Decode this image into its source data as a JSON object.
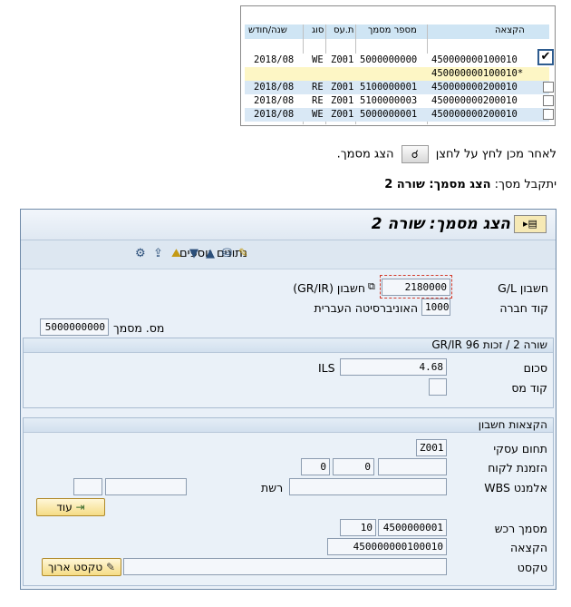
{
  "grid": {
    "columns": [
      "שנה/חודש",
      "סוג",
      "ת.עס",
      "מספר מסמך",
      "הקצאה"
    ],
    "rows": [
      {
        "period": "2018/08",
        "type": "WE",
        "code": "Z001",
        "doc": "5000000000",
        "assignment": "450000000100010",
        "checked": true,
        "style": "white"
      },
      {
        "period": "",
        "type": "",
        "code": "",
        "doc": "",
        "assignment": "450000000100010*",
        "checked": false,
        "style": "yellow"
      },
      {
        "period": "2018/08",
        "type": "RE",
        "code": "Z001",
        "doc": "5100000001",
        "assignment": "450000000200010",
        "checked": false,
        "style": "blue"
      },
      {
        "period": "2018/08",
        "type": "RE",
        "code": "Z001",
        "doc": "5100000003",
        "assignment": "450000000200010",
        "checked": false,
        "style": "white"
      },
      {
        "period": "2018/08",
        "type": "WE",
        "code": "Z001",
        "doc": "5000000001",
        "assignment": "450000000200010",
        "checked": false,
        "style": "blue"
      }
    ]
  },
  "instructions": {
    "line1_before": "לאחר מכן לחץ על לחצן",
    "line1_after": "הצג מסמך.",
    "line2_prefix": "יתקבל מסך:",
    "line2_bold": "הצג מסמך: שורה 2"
  },
  "window": {
    "title": "הצג מסמך: שורה 2",
    "toolbar": {
      "more_data": "נתונים נוספים"
    },
    "header": {
      "gl_account_label": "חשבון G/L",
      "gl_account_value": "2180000",
      "gl_account_desc": "חשבון (GR/IR)",
      "company_code_label": "קוד חברה",
      "company_code_value": "1000",
      "company_code_desc": "האוניברסיטה העברית",
      "doc_no_label": "מס. מסמך",
      "doc_no_value": "5000000000"
    },
    "line_panel": {
      "title": "שורה 2 / זכות 96 GR/IR",
      "amount_label": "סכום",
      "amount_value": "4.68",
      "currency": "ILS",
      "tax_code_label": "קוד מס",
      "tax_code_value": ""
    },
    "assign_panel": {
      "title": "הקצאות חשבון",
      "business_area_label": "תחום עסקי",
      "business_area_value": "Z001",
      "customer_order_label": "הזמנת לקוח",
      "customer_order_a": "0",
      "customer_order_b": "0",
      "wbs_label": "אלמנט WBS",
      "network_label": "רשת",
      "more_button": "עוד",
      "po_label": "מסמך רכש",
      "po_value": "4500000001",
      "po_item": "10",
      "assignment_label": "הקצאה",
      "assignment_value": "450000000100010",
      "text_label": "טקסט",
      "long_text_button": "טקסט ארוך"
    }
  }
}
